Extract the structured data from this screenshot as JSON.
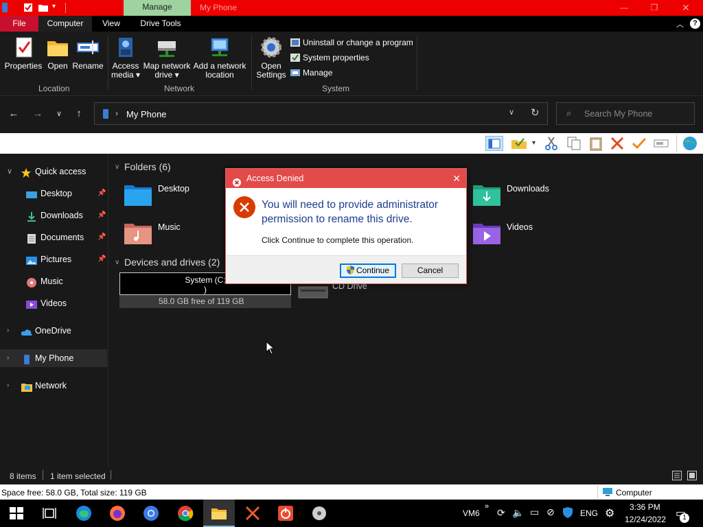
{
  "window": {
    "title": "My Phone",
    "context_tab": "Manage",
    "tabs": [
      "File",
      "Computer",
      "View",
      "Drive Tools"
    ]
  },
  "ribbon": {
    "location": {
      "label": "Location",
      "buttons": [
        "Properties",
        "Open",
        "Rename"
      ]
    },
    "network": {
      "label": "Network",
      "access_media": [
        "Access",
        "media"
      ],
      "map_drive": [
        "Map network",
        "drive"
      ],
      "add_location": [
        "Add a network",
        "location"
      ]
    },
    "system": {
      "label": "System",
      "open_settings": [
        "Open",
        "Settings"
      ],
      "items": [
        "Uninstall or change a program",
        "System properties",
        "Manage"
      ]
    }
  },
  "address": {
    "path": "My Phone",
    "search_placeholder": "Search My Phone"
  },
  "nav": {
    "quick_access": "Quick access",
    "pinned": [
      "Desktop",
      "Downloads",
      "Documents",
      "Pictures"
    ],
    "unpinned": [
      "Music",
      "Videos"
    ],
    "onedrive": "OneDrive",
    "myphone": "My Phone",
    "network": "Network"
  },
  "content": {
    "folders_header": "Folders (6)",
    "folders": [
      "Desktop",
      "Music",
      "Downloads",
      "Videos"
    ],
    "devices_header": "Devices and drives (2)",
    "drive_c": {
      "rename_text": "System (C:\n)",
      "free": "58.0 GB free of 119 GB",
      "fill_fraction": 0.51
    },
    "cd_drive": "CD Drive"
  },
  "dialog": {
    "title": "Access Denied",
    "message": "You will need to provide administrator permission to rename this drive.",
    "sub": "Click Continue to complete this operation.",
    "continue": "Continue",
    "cancel": "Cancel"
  },
  "status": {
    "items": "8 items",
    "selected": "1 item selected",
    "space": "Space free: 58.0 GB, Total size: 119 GB",
    "location": "Computer"
  },
  "taskbar": {
    "vm": "VM6",
    "lang": "ENG",
    "time": "3:36 PM",
    "date": "12/24/2022",
    "notifications": "1"
  },
  "colors": {
    "title_bar": "#ee0000",
    "manage_tab": "#9ed29e",
    "file_tab": "#c8102e",
    "dialog_title": "#e34a4a",
    "dialog_message": "#1b3d8f"
  }
}
